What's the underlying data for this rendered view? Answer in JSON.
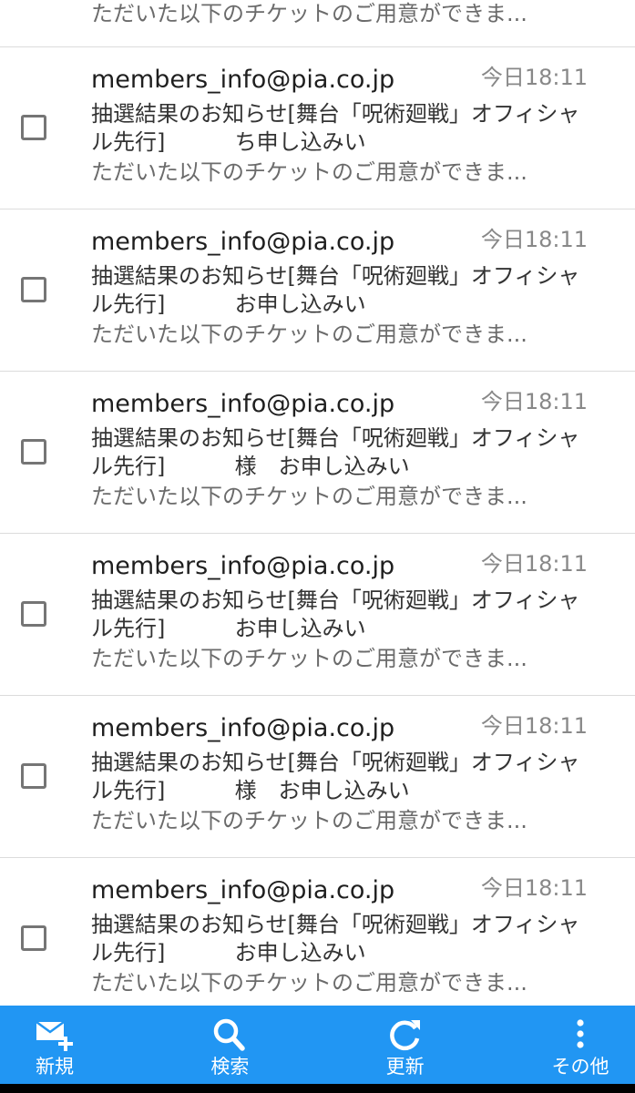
{
  "partial_message": {
    "snippet": "ただいた以下のチケットのご用意ができま..."
  },
  "messages": [
    {
      "sender": "members_info@pia.co.jp",
      "time": "今日18:11",
      "subject": "抽選結果のお知らせ[舞台「呪術廻戦」オフィシャル先行]          ち申し込みい",
      "snippet": "ただいた以下のチケットのご用意ができま..."
    },
    {
      "sender": "members_info@pia.co.jp",
      "time": "今日18:11",
      "subject": "抽選結果のお知らせ[舞台「呪術廻戦」オフィシャル先行]          お申し込みい",
      "snippet": "ただいた以下のチケットのご用意ができま..."
    },
    {
      "sender": "members_info@pia.co.jp",
      "time": "今日18:11",
      "subject": "抽選結果のお知らせ[舞台「呪術廻戦」オフィシャル先行]          様　お申し込みい",
      "snippet": "ただいた以下のチケットのご用意ができま..."
    },
    {
      "sender": "members_info@pia.co.jp",
      "time": "今日18:11",
      "subject": "抽選結果のお知らせ[舞台「呪術廻戦」オフィシャル先行]          お申し込みい",
      "snippet": "ただいた以下のチケットのご用意ができま..."
    },
    {
      "sender": "members_info@pia.co.jp",
      "time": "今日18:11",
      "subject": "抽選結果のお知らせ[舞台「呪術廻戦」オフィシャル先行]          様　お申し込みい",
      "snippet": "ただいた以下のチケットのご用意ができま..."
    },
    {
      "sender": "members_info@pia.co.jp",
      "time": "今日18:11",
      "subject": "抽選結果のお知らせ[舞台「呪術廻戦」オフィシャル先行]          お申し込みい",
      "snippet": "ただいた以下のチケットのご用意ができま..."
    }
  ],
  "toolbar": {
    "new_label": "新規",
    "search_label": "検索",
    "refresh_label": "更新",
    "more_label": "その他"
  },
  "colors": {
    "toolbar_bg": "#2196f3",
    "checkbox_border": "#757575",
    "time_text": "#888888",
    "snippet_text": "#6b6b6b",
    "divider": "#dcdcdc"
  },
  "icons": {
    "new": "new-mail-icon",
    "search": "search-icon",
    "refresh": "refresh-icon",
    "more": "more-vert-icon"
  }
}
